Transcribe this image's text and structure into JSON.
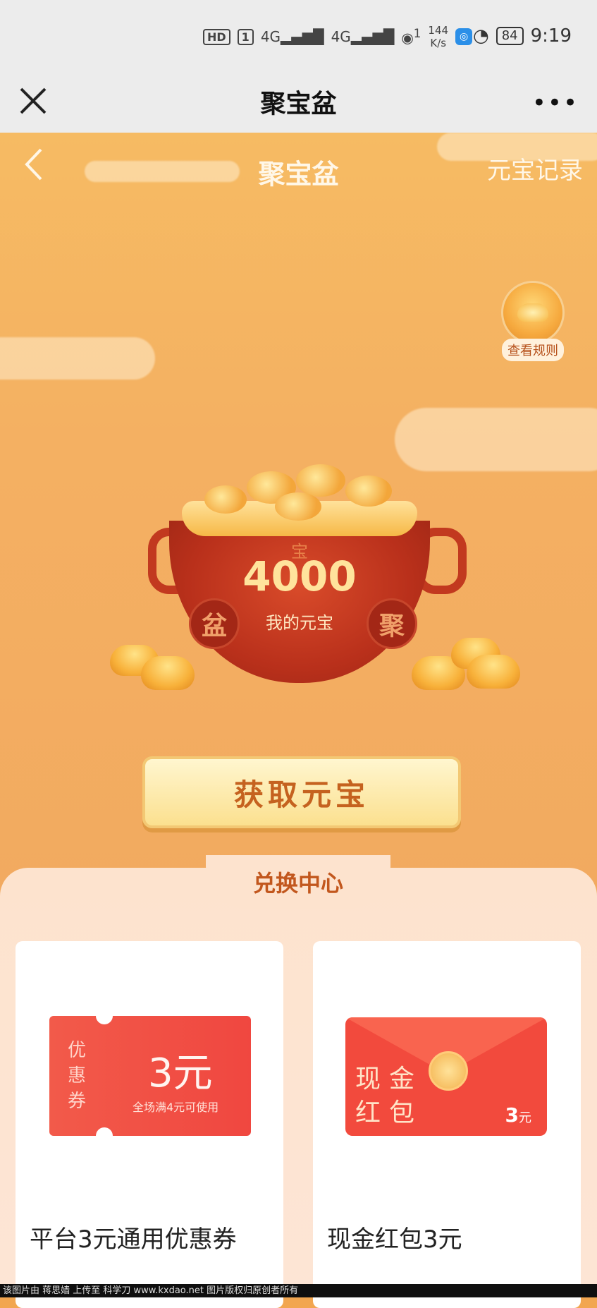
{
  "status_bar": {
    "network_badges": [
      "HD",
      "1",
      "4G",
      "4G"
    ],
    "wifi_label": "1",
    "speed_value": "144",
    "speed_unit": "K/s",
    "battery": "84",
    "time": "9:19"
  },
  "nav": {
    "title": "聚宝盆",
    "more": "•••"
  },
  "hero": {
    "title": "聚宝盆",
    "record_link": "元宝记录",
    "rules_label": "查看规则",
    "pot_value": "4000",
    "pot_label": "我的元宝",
    "pot_side_left": "盆",
    "pot_side_right": "聚",
    "pot_top_char": "宝",
    "get_button": "获取元宝"
  },
  "exchange": {
    "tab_label": "兑换中心",
    "items": [
      {
        "name": "平台3元通用优惠券",
        "coupon_side": [
          "优",
          "惠",
          "券"
        ],
        "coupon_amount": "3元",
        "coupon_desc": "全场满4元可使用"
      },
      {
        "name": "现金红包3元",
        "rp_line1": "现金",
        "rp_line2": "红包",
        "rp_amount": "3",
        "rp_unit": "元"
      }
    ]
  },
  "watermark": "该图片由 蒋思嫱 上传至 科学刀 www.kxdao.net 图片版权归原创者所有",
  "colors": {
    "hero_bg": "#f4b062",
    "pot_red": "#b9301b",
    "gold": "#f8b13a",
    "coupon_red": "#f25a4a",
    "exchange_bg": "#fde3ce"
  }
}
